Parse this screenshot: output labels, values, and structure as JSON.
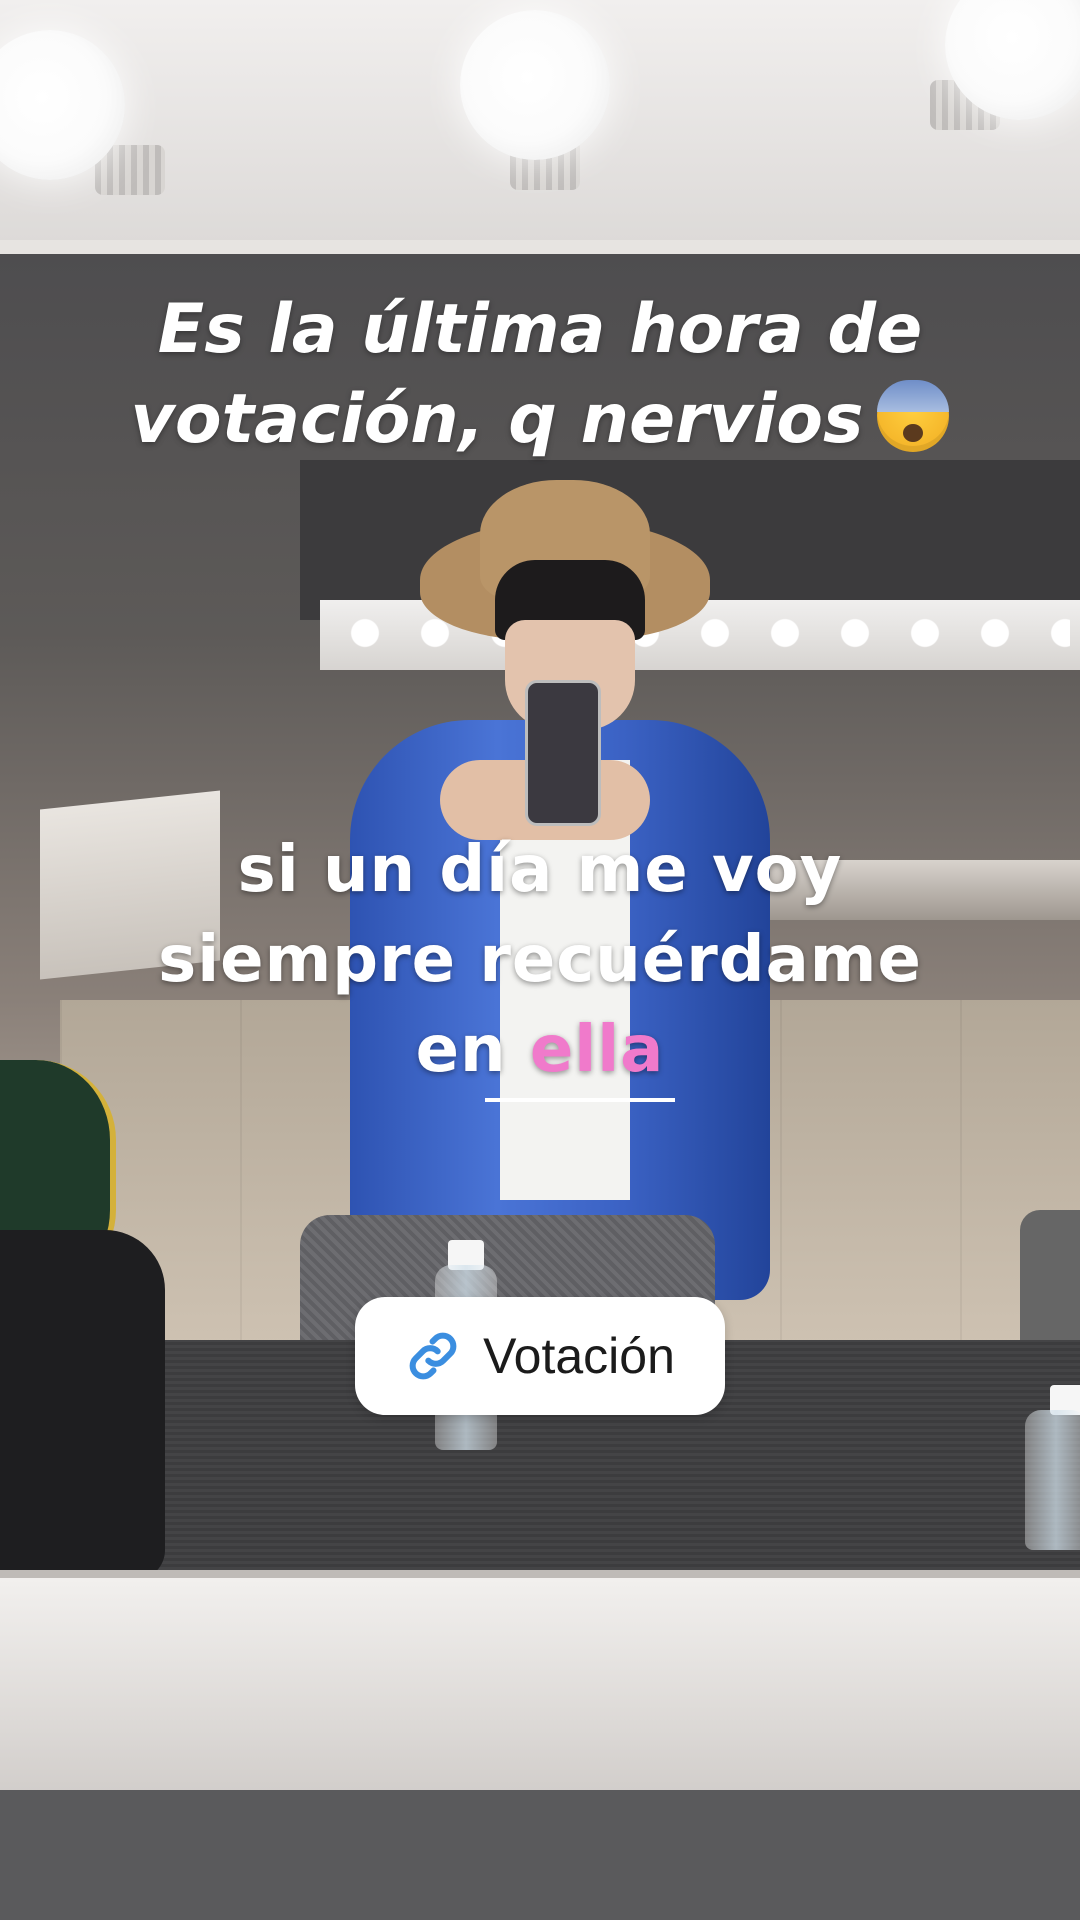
{
  "story": {
    "title_line1": "Es la última hora de",
    "title_line2": "votación, q nervios",
    "title_emoji": "anxious-face-emoji",
    "lyrics": {
      "line1": "si un día me voy",
      "line2": "siempre recuérdame",
      "line3_prefix": "en",
      "line3_highlight": "ella"
    },
    "link_sticker": {
      "label": "Votación",
      "icon": "link-icon"
    }
  },
  "colors": {
    "highlight": "#f07acb",
    "link_icon": "#3b8ee0",
    "text": "#ffffff"
  }
}
